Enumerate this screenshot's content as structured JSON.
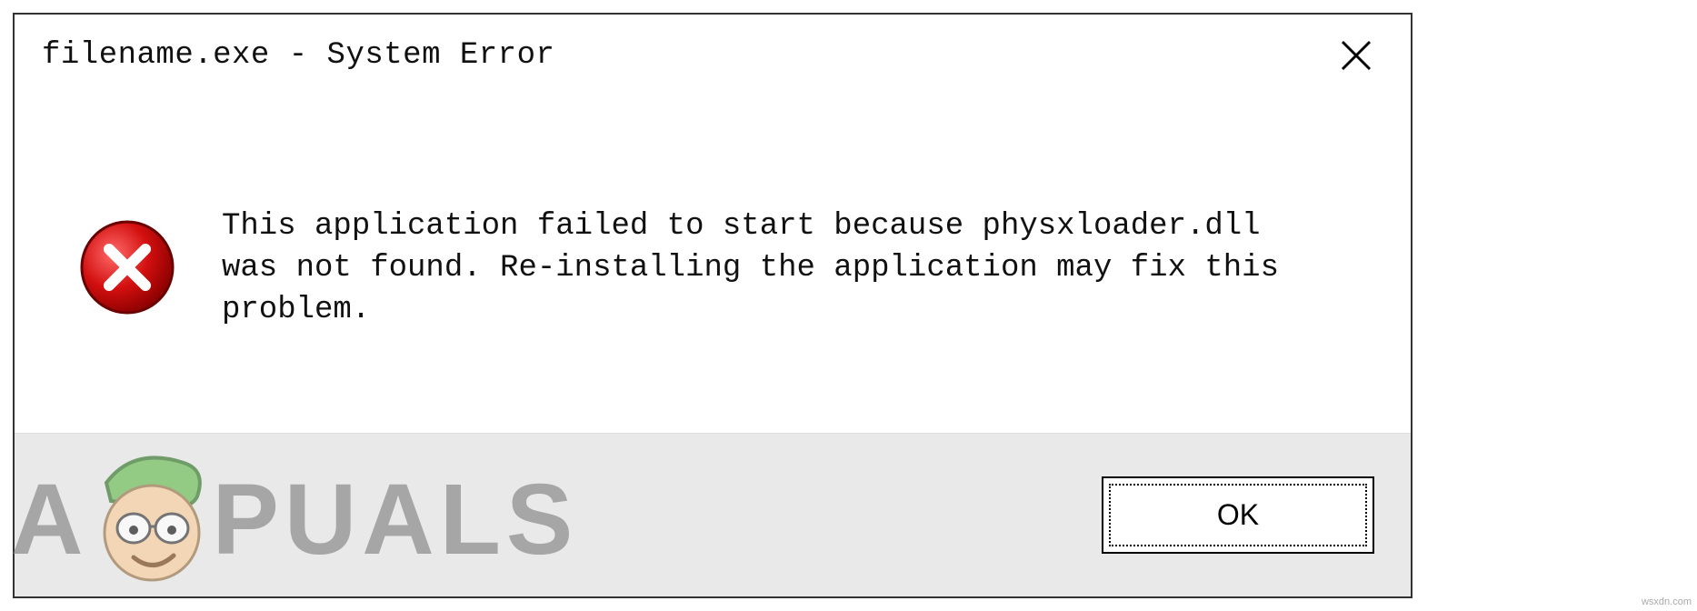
{
  "dialog": {
    "title": "filename.exe - System Error",
    "message": "This application failed to start because physxloader.dll was not found. Re-installing the application may fix this problem.",
    "ok_label": "OK"
  },
  "watermark": {
    "letter_left": "A",
    "letter_right": "PUALS"
  },
  "source_note": "wsxdn.com"
}
